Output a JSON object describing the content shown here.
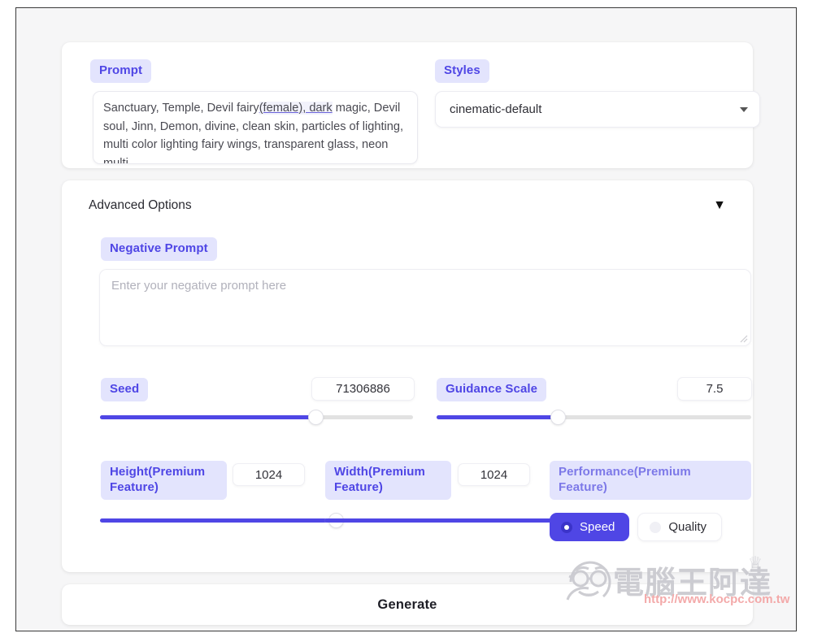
{
  "prompt_section": {
    "prompt_label": "Prompt",
    "prompt_text": "Sanctuary, Temple, Devil fairy(female), dark magic, Devil soul, Jinn, Demon, divine, clean skin, particles of lighting, multi color lighting fairy wings, transparent glass, neon multi",
    "prompt_text_plain_head": "Sanctuary, Temple, Devil fairy",
    "prompt_text_misspelled": "(female), dark",
    "prompt_text_tail": " magic, Devil soul, Jinn, Demon, divine, clean skin, particles of lighting, multi color lighting fairy wings, transparent glass, neon multi",
    "styles_label": "Styles",
    "styles_selected": "cinematic-default",
    "styles_caret_icon": "chevron-down-icon"
  },
  "advanced": {
    "title": "Advanced Options",
    "collapse_caret": "▼",
    "negative_prompt_label": "Negative Prompt",
    "negative_prompt_value": "",
    "negative_prompt_placeholder": "Enter your negative prompt here",
    "resize_handle_icon": "resize-grip-icon",
    "seed": {
      "label": "Seed",
      "value": "71306886",
      "slider_percent": 70
    },
    "guidance_scale": {
      "label": "Guidance Scale",
      "value": "7.5",
      "slider_percent": 38
    },
    "height": {
      "label": "Height(Premium Feature)",
      "value": "1024",
      "slider_percent": 100
    },
    "width": {
      "label": "Width(Premium Feature)",
      "value": "1024",
      "slider_percent": 100
    },
    "performance": {
      "label": "Performance(Premium Feature)",
      "options": [
        {
          "label": "Speed",
          "selected": true
        },
        {
          "label": "Quality",
          "selected": false
        }
      ],
      "speed_label": "Speed",
      "quality_label": "Quality"
    }
  },
  "generate": {
    "label": "Generate"
  },
  "watermark": {
    "cjk_text": "電腦王阿達",
    "url": "http://www.kocpc.com.tw",
    "crown_icon": "crown-icon",
    "face_icon": "smiling-face-with-glasses-icon"
  },
  "colors": {
    "accent": "#4f46e5",
    "pill_bg": "#e3e4fd",
    "pill_text": "#4f46e5",
    "page_bg": "#f6f6f7",
    "card_bg": "#ffffff",
    "slider_track": "#e2e2e2",
    "watermark_url": "#f3a3a3"
  }
}
